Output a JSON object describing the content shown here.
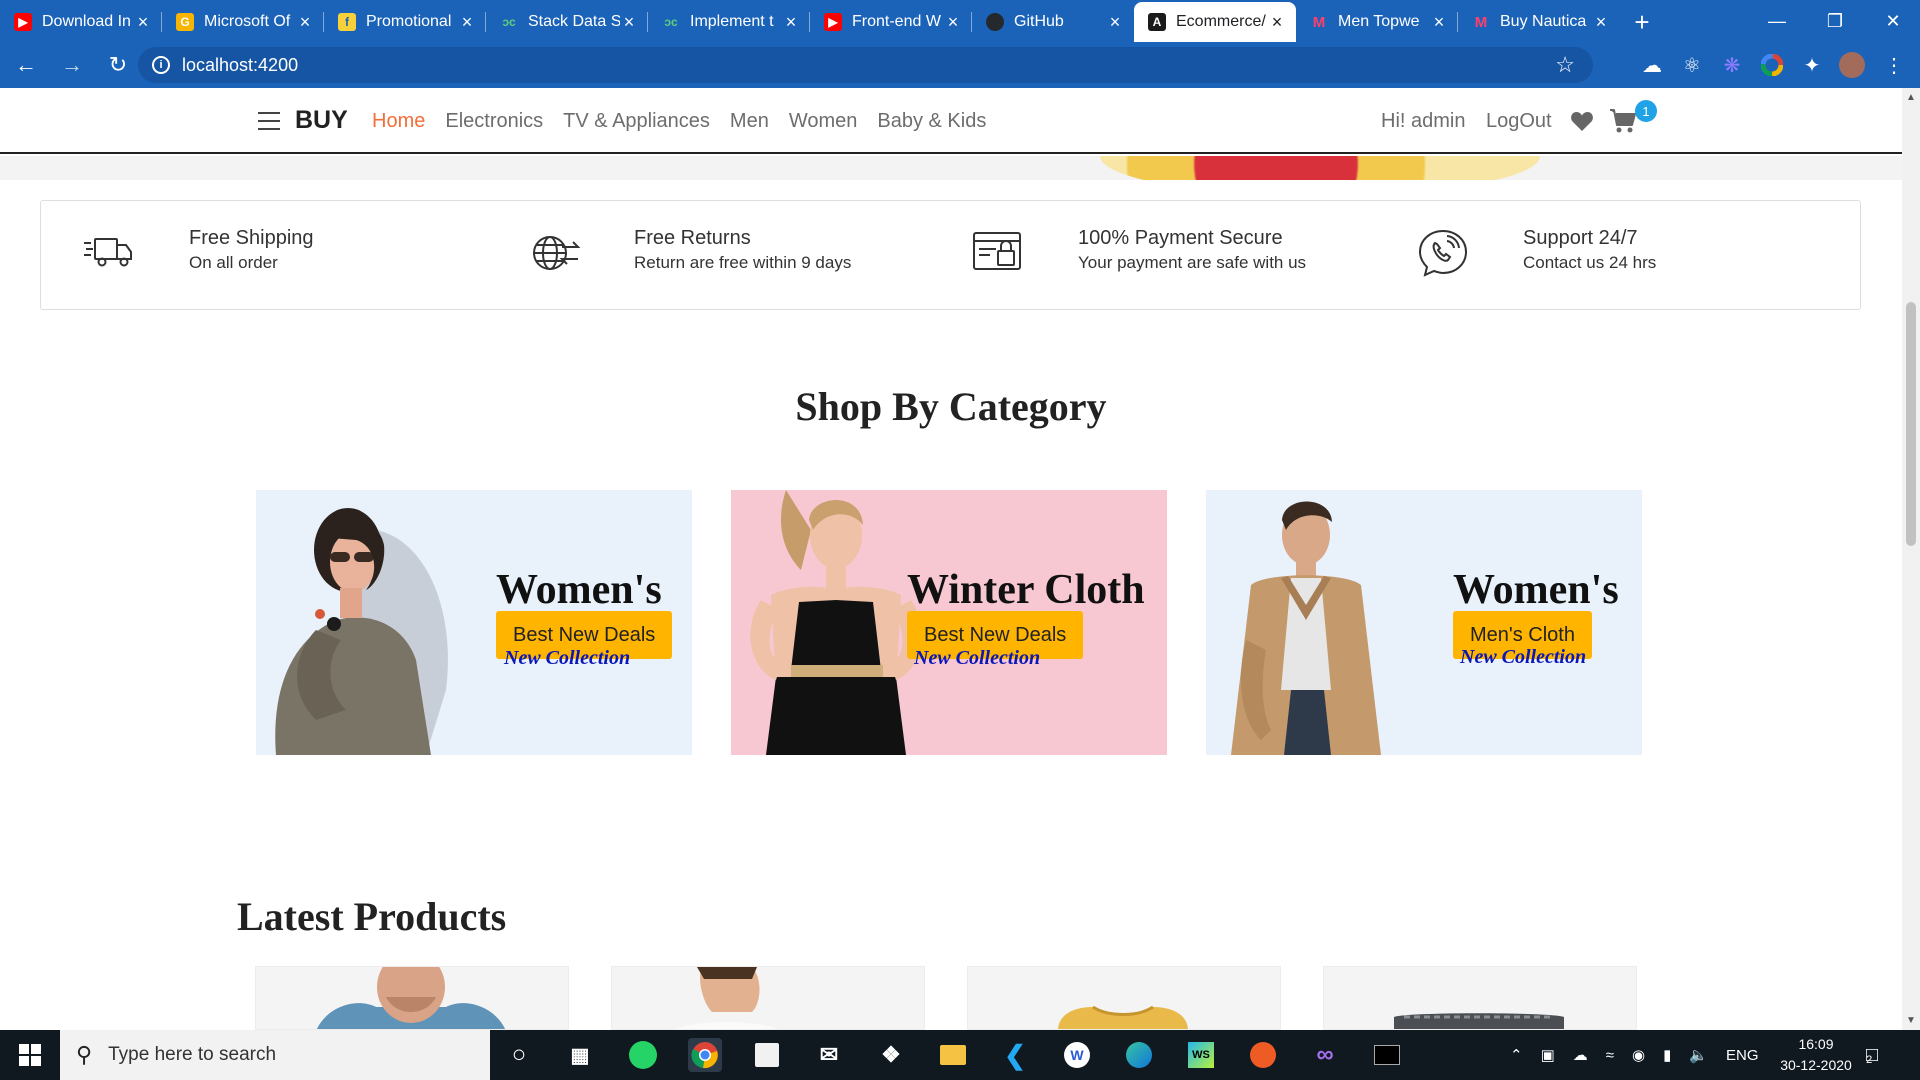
{
  "browser": {
    "tabs": [
      {
        "title": "Download In",
        "favicon": "youtube-icon",
        "color": "#ff0000"
      },
      {
        "title": "Microsoft Of",
        "favicon": "google-g-icon",
        "color": "#f7b500"
      },
      {
        "title": "Promotional",
        "favicon": "flipkart-icon",
        "color": "#f8d03a"
      },
      {
        "title": "Stack Data S",
        "favicon": "geeksforgeeks-icon",
        "color": "#2f8d46"
      },
      {
        "title": "Implement t",
        "favicon": "geeksforgeeks-icon",
        "color": "#2f8d46"
      },
      {
        "title": "Front-end W",
        "favicon": "youtube-icon",
        "color": "#ff0000"
      },
      {
        "title": "GitHub",
        "favicon": "github-icon",
        "color": "#24292e"
      },
      {
        "title": "Ecommerce/",
        "favicon": "angular-icon",
        "color": "#1b1b1b",
        "active": true
      },
      {
        "title": "Men Topwe",
        "favicon": "myntra-icon",
        "color": "#ff3f6c"
      },
      {
        "title": "Buy Nautica",
        "favicon": "myntra-icon",
        "color": "#ff3f6c"
      }
    ],
    "url": "localhost:4200"
  },
  "site": {
    "logo": "BUY",
    "nav": [
      "Home",
      "Electronics",
      "TV & Appliances",
      "Men",
      "Women",
      "Baby & Kids"
    ],
    "greeting": "Hi! admin",
    "logout": "LogOut",
    "cart_count": "1"
  },
  "features": [
    {
      "title": "Free Shipping",
      "subtitle": "On all order",
      "icon": "truck-icon"
    },
    {
      "title": "Free Returns",
      "subtitle": "Return are free within 9 days",
      "icon": "globe-arrows-icon"
    },
    {
      "title": "100% Payment Secure",
      "subtitle": "Your payment are safe with us",
      "icon": "card-lock-icon"
    },
    {
      "title": "Support 24/7",
      "subtitle": "Contact us 24 hrs",
      "icon": "phone-support-icon"
    }
  ],
  "shop_by_category": {
    "title": "Shop By Category",
    "cards": [
      {
        "heading": "Women's",
        "button": "Best New Deals",
        "tag": "New Collection",
        "bg": "#e9f2fb"
      },
      {
        "heading": "Winter Cloth",
        "button": "Best New Deals",
        "tag": "New Collection",
        "bg": "#f8c8d2"
      },
      {
        "heading": "Women's",
        "button": "Men's Cloth",
        "tag": "New Collection",
        "bg": "#e9f2fb"
      }
    ]
  },
  "latest_products": {
    "title": "Latest Products"
  },
  "taskbar": {
    "search_placeholder": "Type here to search",
    "lang": "ENG",
    "time": "16:09",
    "date": "30-12-2020",
    "notifications": "2"
  },
  "colors": {
    "browser_blue": "#1b63b8",
    "nav_active": "#f06f3b",
    "deal_button": "#ffb400",
    "badge": "#1fa3e6"
  }
}
